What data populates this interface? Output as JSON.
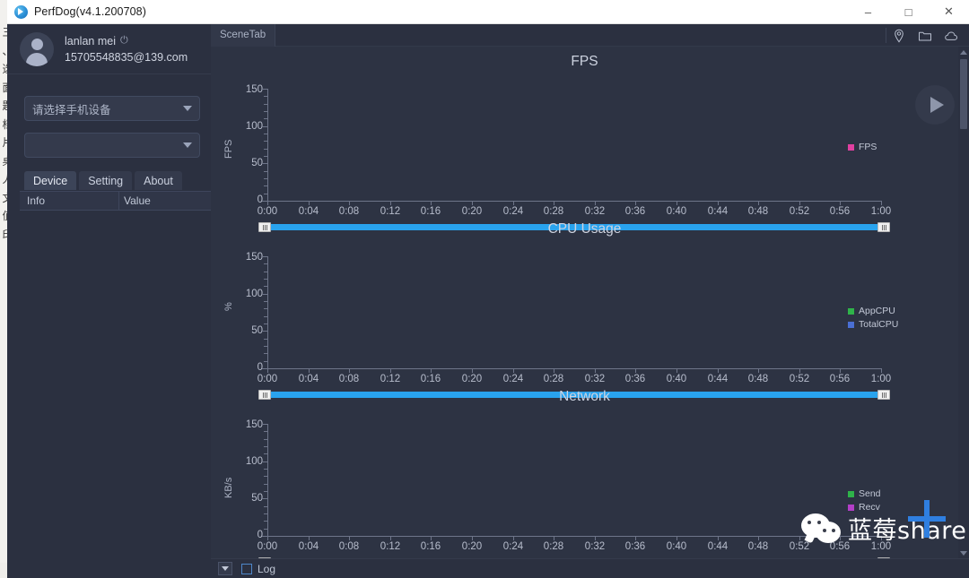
{
  "background_window": {
    "left_column_glyphs": "三\n、\n选\n面\n题\n档\n片\n桌\n人\n文\n值\n印"
  },
  "titlebar": {
    "title": "PerfDog(v4.1.200708)",
    "logo_icon": "perfdog-logo-icon",
    "minimize": "–",
    "maximize": "□",
    "close": "✕"
  },
  "sidebar": {
    "user": {
      "name": "lanlan mei",
      "power_icon": "⏻",
      "email": "15705548835@139.com",
      "avatar_icon": "user-avatar-icon"
    },
    "device_select": {
      "value": "请选择手机设备",
      "arrow_icon": "chevron-down-icon"
    },
    "app_select": {
      "value": "",
      "arrow_icon": "chevron-down-icon"
    },
    "tabs": [
      {
        "label": "Device",
        "active": true
      },
      {
        "label": "Setting",
        "active": false
      },
      {
        "label": "About",
        "active": false
      }
    ],
    "table": {
      "columns": [
        "Info",
        "Value"
      ],
      "rows": []
    }
  },
  "main": {
    "scene_tab": "SceneTab",
    "header_icons": [
      "location-pin-icon",
      "folder-icon",
      "cloud-icon"
    ],
    "play_button": "play-icon",
    "bottom": {
      "dropdown_icon": "chevron-down-icon",
      "log_label": "Log",
      "log_checked": false
    }
  },
  "chart_data": [
    {
      "type": "line",
      "title": "FPS",
      "ylabel": "FPS",
      "xlabel": "",
      "ylim": [
        0,
        150
      ],
      "yticks": [
        0,
        50,
        100,
        150
      ],
      "xticks": [
        "0:00",
        "0:04",
        "0:08",
        "0:12",
        "0:16",
        "0:20",
        "0:24",
        "0:28",
        "0:32",
        "0:36",
        "0:40",
        "0:44",
        "0:48",
        "0:52",
        "0:56",
        "1:00"
      ],
      "grid": false,
      "legend_position": "right",
      "series": [
        {
          "name": "FPS",
          "color": "#e040a0",
          "values": []
        }
      ],
      "scrollbar": {
        "start_pct": 0,
        "end_pct": 100
      }
    },
    {
      "type": "line",
      "title": "CPU Usage",
      "ylabel": "%",
      "xlabel": "",
      "ylim": [
        0,
        150
      ],
      "yticks": [
        0,
        50,
        100,
        150
      ],
      "xticks": [
        "0:00",
        "0:04",
        "0:08",
        "0:12",
        "0:16",
        "0:20",
        "0:24",
        "0:28",
        "0:32",
        "0:36",
        "0:40",
        "0:44",
        "0:48",
        "0:52",
        "0:56",
        "1:00"
      ],
      "grid": false,
      "legend_position": "right",
      "series": [
        {
          "name": "AppCPU",
          "color": "#2fb34a",
          "values": []
        },
        {
          "name": "TotalCPU",
          "color": "#4a6fd4",
          "values": []
        }
      ],
      "scrollbar": {
        "start_pct": 0,
        "end_pct": 100
      }
    },
    {
      "type": "line",
      "title": "Network",
      "ylabel": "KB/s",
      "xlabel": "",
      "ylim": [
        0,
        150
      ],
      "yticks": [
        0,
        50,
        100,
        150
      ],
      "xticks": [
        "0:00",
        "0:04",
        "0:08",
        "0:12",
        "0:16",
        "0:20",
        "0:24",
        "0:28",
        "0:32",
        "0:36",
        "0:40",
        "0:44",
        "0:48",
        "0:52",
        "0:56",
        "1:00"
      ],
      "grid": false,
      "legend_position": "right",
      "series": [
        {
          "name": "Send",
          "color": "#2fb34a",
          "values": []
        },
        {
          "name": "Recv",
          "color": "#b33fc8",
          "values": []
        }
      ],
      "scrollbar": {
        "start_pct": 0,
        "end_pct": 100
      }
    }
  ],
  "watermark": {
    "text": "蓝莓share",
    "wechat_icon": "wechat-icon",
    "plus_icon": "plus-icon"
  }
}
